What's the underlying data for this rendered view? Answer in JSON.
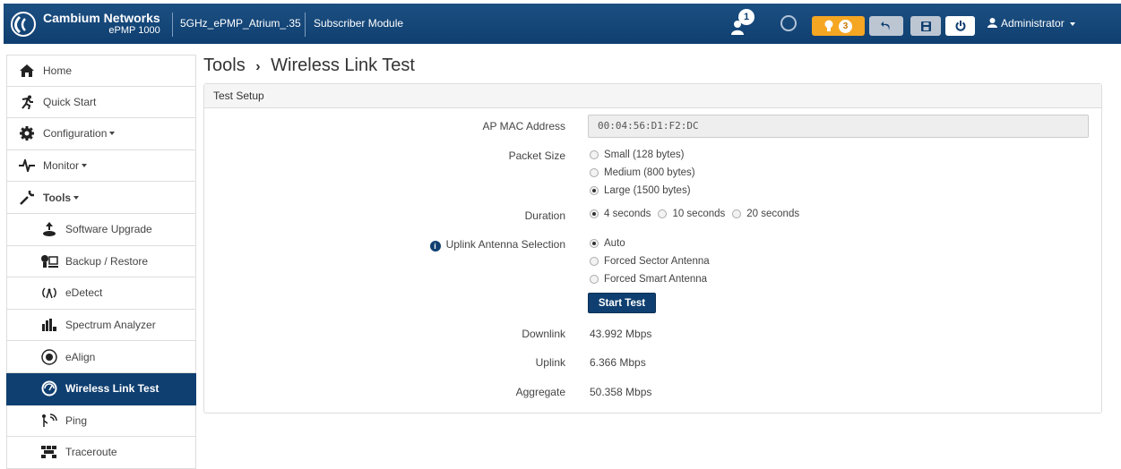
{
  "header": {
    "brand": "Cambium Networks",
    "model": "ePMP 1000",
    "device_name": "5GHz_ePMP_Atrium_.35",
    "device_mode": "Subscriber Module",
    "notification_count": "1",
    "alerts_count": "3",
    "user": "Administrator",
    "colors": {
      "bar": "#0f3f70",
      "alert": "#f5a623"
    }
  },
  "sidebar": {
    "items": [
      {
        "label": "Home",
        "icon": "home-icon"
      },
      {
        "label": "Quick Start",
        "icon": "quick-start-icon"
      },
      {
        "label": "Configuration",
        "icon": "gear-icon"
      },
      {
        "label": "Monitor",
        "icon": "pulse-icon"
      },
      {
        "label": "Tools",
        "icon": "wrench-icon"
      },
      {
        "label": "Software Upgrade",
        "icon": "upgrade-icon"
      },
      {
        "label": "Backup / Restore",
        "icon": "backup-icon"
      },
      {
        "label": "eDetect",
        "icon": "edetect-icon"
      },
      {
        "label": "Spectrum Analyzer",
        "icon": "bar-chart-icon"
      },
      {
        "label": "eAlign",
        "icon": "ealign-icon"
      },
      {
        "label": "Wireless Link Test",
        "icon": "speedometer-icon"
      },
      {
        "label": "Ping",
        "icon": "ping-icon"
      },
      {
        "label": "Traceroute",
        "icon": "traceroute-icon"
      }
    ]
  },
  "main": {
    "breadcrumb_parent": "Tools",
    "breadcrumb_sep": "›",
    "title": "Wireless Link Test",
    "panel_title": "Test Setup",
    "ap_mac_label": "AP MAC Address",
    "ap_mac_value": "00:04:56:D1:F2:DC",
    "packet_size_label": "Packet Size",
    "packet_sizes": [
      "Small (128 bytes)",
      "Medium (800 bytes)",
      "Large (1500 bytes)"
    ],
    "packet_size_selected": "Large (1500 bytes)",
    "duration_label": "Duration",
    "durations": [
      "4 seconds",
      "10 seconds",
      "20 seconds"
    ],
    "duration_selected": "4 seconds",
    "antenna_label": "Uplink Antenna Selection",
    "antennas": [
      "Auto",
      "Forced Sector Antenna",
      "Forced Smart Antenna"
    ],
    "antenna_selected": "Auto",
    "start_button": "Start Test",
    "downlink_label": "Downlink",
    "downlink_value": "43.992 Mbps",
    "uplink_label": "Uplink",
    "uplink_value": "6.366 Mbps",
    "aggregate_label": "Aggregate",
    "aggregate_value": "50.358 Mbps"
  }
}
